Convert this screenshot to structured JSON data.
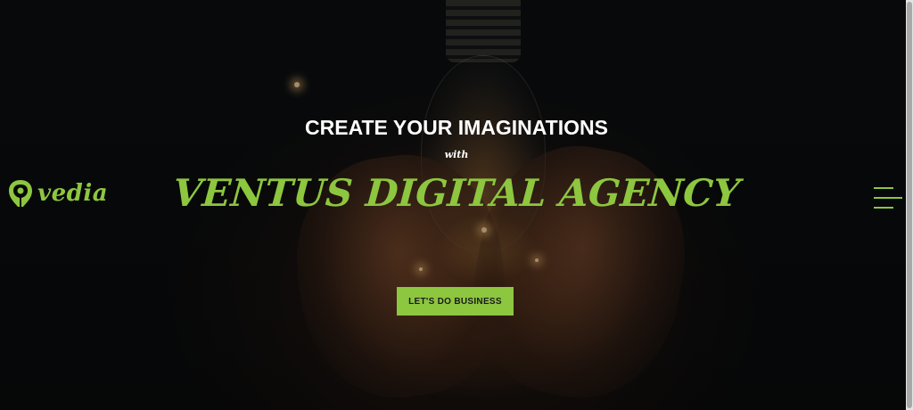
{
  "brand": {
    "name": "vedia",
    "accent_color": "#8dc63f"
  },
  "hero": {
    "headline": "CREATE YOUR IMAGINATIONS",
    "connector": "with",
    "agency_name": "VENTUS DIGITAL AGENCY",
    "cta_label": "LET'S DO BUSINESS",
    "background": "lightbulb-in-hands-photo"
  },
  "nav": {
    "menu_icon": "hamburger-menu-icon"
  }
}
